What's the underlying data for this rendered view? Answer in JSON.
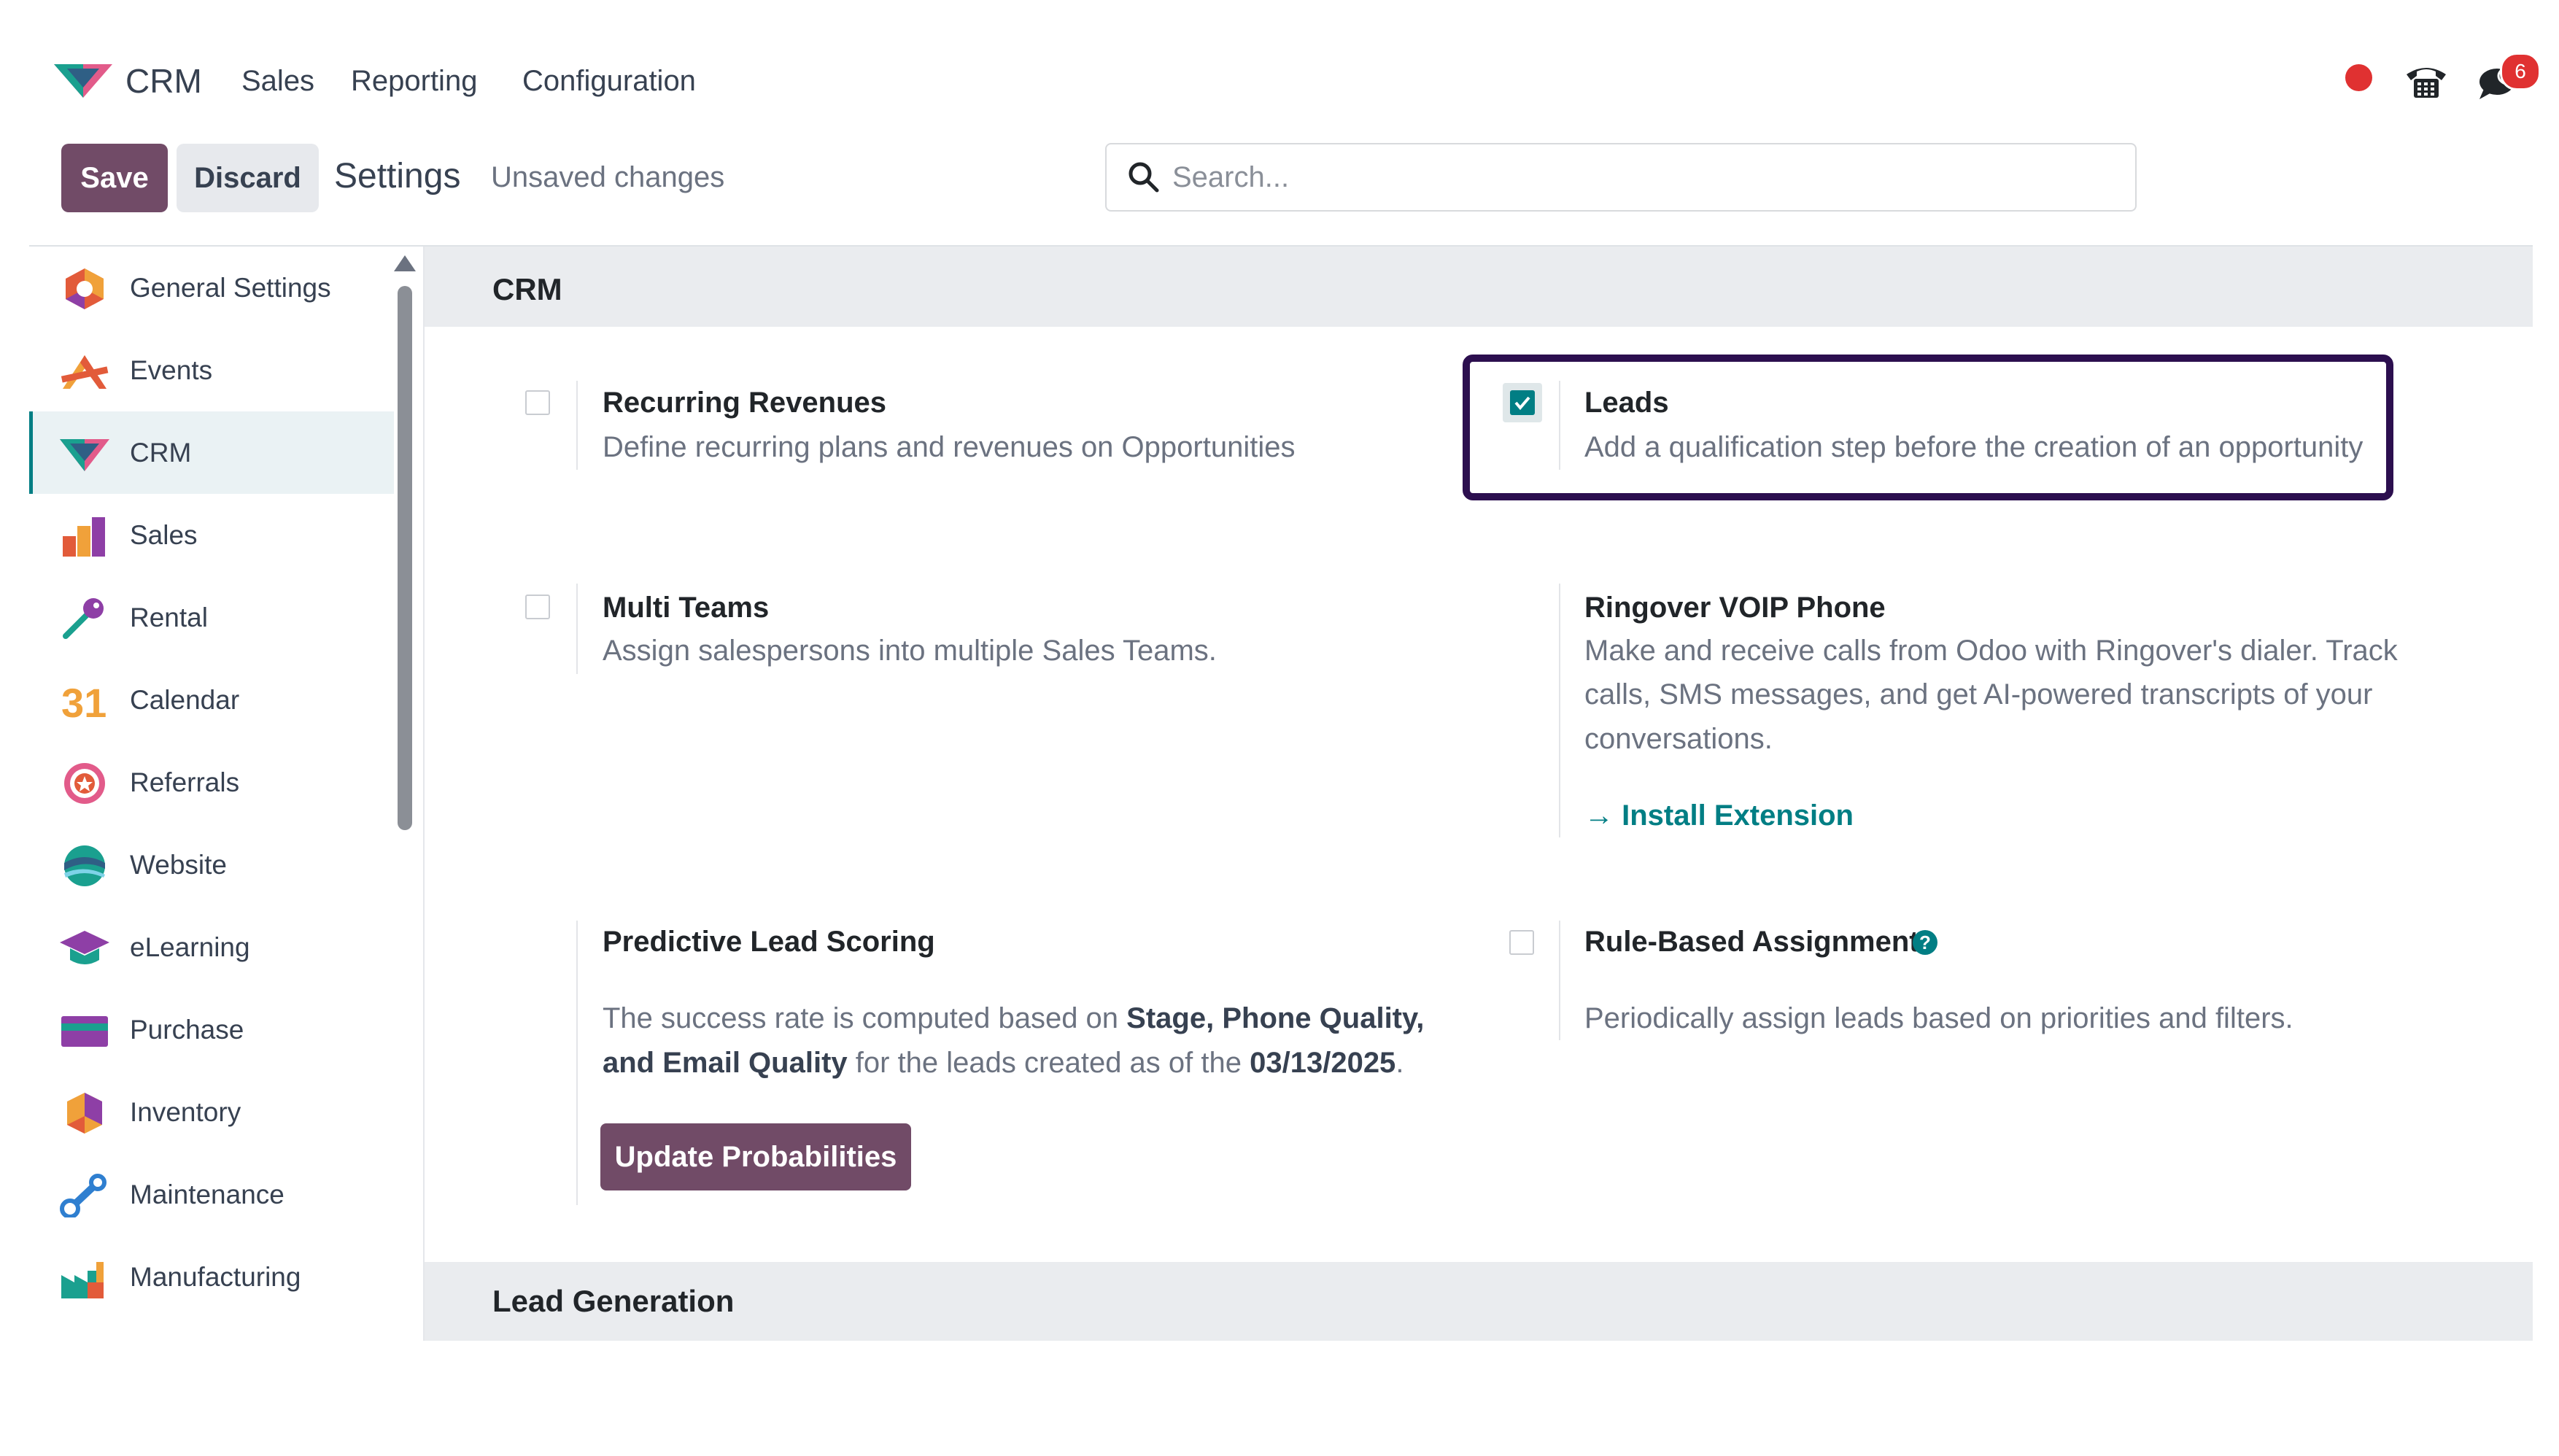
{
  "navbar": {
    "app_name": "CRM",
    "menu": [
      "Sales",
      "Reporting",
      "Configuration"
    ],
    "chat_badge_count": "6",
    "icons": [
      "crm-logo-icon",
      "recording-dot-icon",
      "phone-icon",
      "chat-icon"
    ]
  },
  "control_panel": {
    "save_label": "Save",
    "discard_label": "Discard",
    "title": "Settings",
    "status": "Unsaved changes",
    "search_placeholder": "Search..."
  },
  "sidebar": {
    "items": [
      {
        "label": "General Settings",
        "icon": "general-settings-icon"
      },
      {
        "label": "Events",
        "icon": "events-icon"
      },
      {
        "label": "CRM",
        "icon": "crm-icon",
        "active": true
      },
      {
        "label": "Sales",
        "icon": "sales-icon"
      },
      {
        "label": "Rental",
        "icon": "rental-icon"
      },
      {
        "label": "Calendar",
        "icon": "calendar-icon",
        "glyph": "31"
      },
      {
        "label": "Referrals",
        "icon": "referrals-icon"
      },
      {
        "label": "Website",
        "icon": "website-icon"
      },
      {
        "label": "eLearning",
        "icon": "elearning-icon"
      },
      {
        "label": "Purchase",
        "icon": "purchase-icon"
      },
      {
        "label": "Inventory",
        "icon": "inventory-icon"
      },
      {
        "label": "Maintenance",
        "icon": "maintenance-icon"
      },
      {
        "label": "Manufacturing",
        "icon": "manufacturing-icon"
      }
    ]
  },
  "sections": {
    "crm": "CRM",
    "lead_generation": "Lead Generation"
  },
  "settings": {
    "recurring_revenues": {
      "title": "Recurring Revenues",
      "desc": "Define recurring plans and revenues on Opportunities",
      "checked": false
    },
    "leads": {
      "title": "Leads",
      "desc": "Add a qualification step before the creation of an opportunity",
      "checked": true
    },
    "multi_teams": {
      "title": "Multi Teams",
      "desc": "Assign salespersons into multiple Sales Teams.",
      "checked": false
    },
    "ringover": {
      "title": "Ringover VOIP Phone",
      "desc_line1": "Make and receive calls from Odoo with Ringover's dialer. Track",
      "desc_line2": "calls, SMS messages, and get AI-powered transcripts of your",
      "desc_line3": "conversations.",
      "link_arrow": "→",
      "link": "Install Extension"
    },
    "predictive": {
      "title": "Predictive Lead Scoring",
      "text1": "The success rate is computed based on ",
      "bold1": "Stage, Phone Quality,",
      "bold2": "and Email Quality",
      "text2": " for the leads created as of the ",
      "date": "03/13/2025",
      "text3": ".",
      "button": "Update Probabilities"
    },
    "rule_based": {
      "title": "Rule-Based Assignment",
      "help": "?",
      "desc": "Periodically assign leads based on priorities and filters.",
      "checked": false
    }
  },
  "colors": {
    "primary": "#714b67",
    "accent": "#017e84",
    "highlight_border": "#2c0f4f",
    "badge": "#e03131"
  }
}
